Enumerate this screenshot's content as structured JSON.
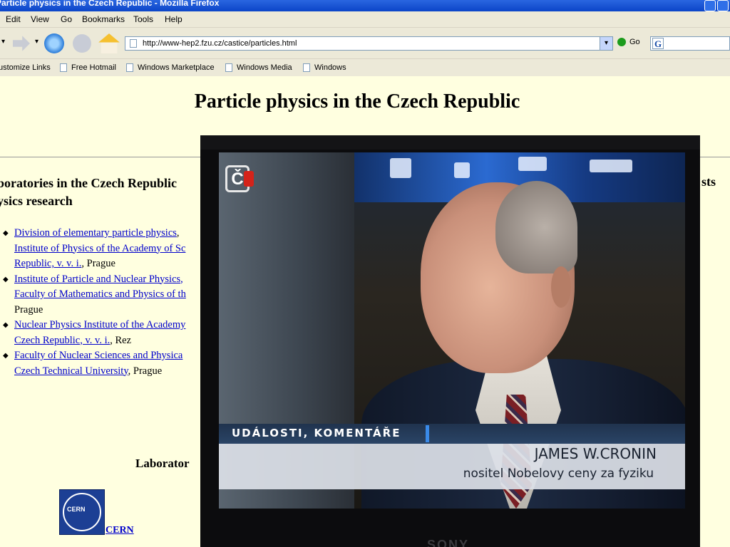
{
  "window": {
    "title": "Particle physics in the Czech Republic - Mozilla Firefox"
  },
  "menu": [
    "Edit",
    "View",
    "Go",
    "Bookmarks",
    "Tools",
    "Help"
  ],
  "nav": {
    "url": "http://www-hep2.fzu.cz/castice/particles.html",
    "go_label": "Go",
    "search_logo": "G"
  },
  "links_bar": [
    "ustomize Links",
    "Free Hotmail",
    "Windows Marketplace",
    "Windows Media",
    "Windows"
  ],
  "page": {
    "title": "Particle physics in the Czech Republic",
    "section_line1": "boratories in the Czech Republic",
    "section_line2": "ysics research",
    "right_fragment": "sts",
    "labs": [
      {
        "line1_link": "Division of elementary particle physics",
        "line1_rest": ",",
        "line2_link": "Institute of Physics of the Academy of Sc",
        "line3_link": "Republic, v. v. i.",
        "line3_rest": ", Prague"
      },
      {
        "line1_link": "Institute of Particle and Nuclear Physics,",
        "line2_link": "Faculty of Mathematics and Physics of th",
        "line3_text": "Prague"
      },
      {
        "line1_link": "Nuclear Physics Institute of the Academy",
        "line2_link": "Czech Republic, v. v. i.",
        "line2_rest": ", Rez"
      },
      {
        "line1_link": "Faculty of Nuclear Sciences and Physica",
        "line2_link": "Czech Technical University",
        "line2_rest": ", Prague"
      }
    ],
    "second_heading": "Laborator",
    "cern_logo_text": "CERN",
    "cern_link": "CERN"
  },
  "tv": {
    "channel_logo": "Č",
    "program_band": "UDÁLOSTI, KOMENTÁŘE",
    "person_name": "JAMES W.CRONIN",
    "person_caption": "nositel Nobelovy ceny za fyziku",
    "brand": "SONY"
  },
  "colors": {
    "page_bg": "#ffffe0",
    "link": "#0000cc",
    "titlebar": "#0b45c8",
    "chrome": "#ece9d8"
  }
}
